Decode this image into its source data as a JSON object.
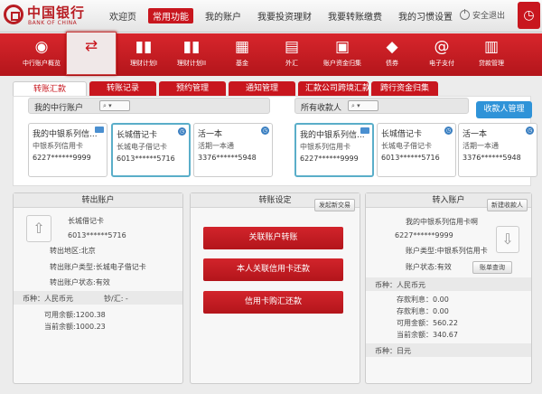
{
  "header": {
    "logo_cn": "中国银行",
    "logo_en": "BANK OF CHINA",
    "nav": [
      "欢迎页",
      "常用功能",
      "我的账户",
      "我要投资理财",
      "我要转账缴费",
      "我的习惯设置"
    ],
    "nav_active": "常用功能",
    "logout": "安全退出"
  },
  "iconbar": {
    "items": [
      {
        "label": "中行账户概览",
        "icon": "account-overview-icon"
      },
      {
        "label": "",
        "icon": "transfer-icon",
        "selected": true
      },
      {
        "label": "理财计划I",
        "icon": "chart-icon"
      },
      {
        "label": "理财计划II",
        "icon": "chart-icon"
      },
      {
        "label": "基金",
        "icon": "fund-icon"
      },
      {
        "label": "外汇",
        "icon": "forex-icon"
      },
      {
        "label": "账户资金归集",
        "icon": "fund-collect-icon"
      },
      {
        "label": "债券",
        "icon": "bond-icon"
      },
      {
        "label": "电子支付",
        "icon": "epay-icon"
      },
      {
        "label": "贷款管理",
        "icon": "loan-icon"
      }
    ]
  },
  "tabs": [
    "转账汇款",
    "转账记录",
    "预约管理",
    "通知管理",
    "汇款公司跨境汇款",
    "跨行资金归集"
  ],
  "my_accounts": {
    "title": "我的中行账户",
    "cards": [
      {
        "name": "我的中银系列信...",
        "type": "中银系列信用卡",
        "number": "6227******9999"
      },
      {
        "name": "长城借记卡",
        "type": "长城电子借记卡",
        "number": "6013******5716"
      },
      {
        "name": "活一本",
        "type": "活期一本通",
        "number": "3376******5948"
      }
    ]
  },
  "payees": {
    "title": "所有收款人",
    "manage_button": "收款人管理",
    "cards": [
      {
        "name": "我的中银系列信...",
        "type": "中银系列信用卡",
        "number": "6227******9999"
      },
      {
        "name": "长城借记卡",
        "type": "长城电子借记卡",
        "number": "6013******5716"
      },
      {
        "name": "活一本",
        "type": "活期一本通",
        "number": "3376******5948"
      }
    ]
  },
  "out_account": {
    "title": "转出账户",
    "card_name": "长城借记卡",
    "card_number": "6013******5716",
    "region": "转出地区:北京",
    "type": "转出账户类型:长城电子借记卡",
    "status": "转出账户状态:有效",
    "currency": "币种：人民币元",
    "cash_remit": "钞/汇: -",
    "available": "可用余额:1200.38",
    "current": "当前余额:1000.23"
  },
  "transfer_settings": {
    "title": "转账设定",
    "new_button": "发起新交易",
    "buttons": [
      "关联账户转账",
      "本人关联信用卡还款",
      "信用卡购汇还款"
    ]
  },
  "in_account": {
    "title": "转入账户",
    "new_payee_button": "新建收款人",
    "card_name": "我的中银系列信用卡啊",
    "card_number": "6227******9999",
    "type": "账户类型:中银系列信用卡",
    "status": "账户状态:有效",
    "query_button": "账单查询",
    "currency_rmb": "币种：人民币元",
    "deposit_interest": "存款利息：0.00",
    "loan_interest": "存款利息：0.00",
    "available": "可用金额：560.22",
    "current": "当前余额：340.67",
    "currency_jpy": "币种：日元"
  }
}
